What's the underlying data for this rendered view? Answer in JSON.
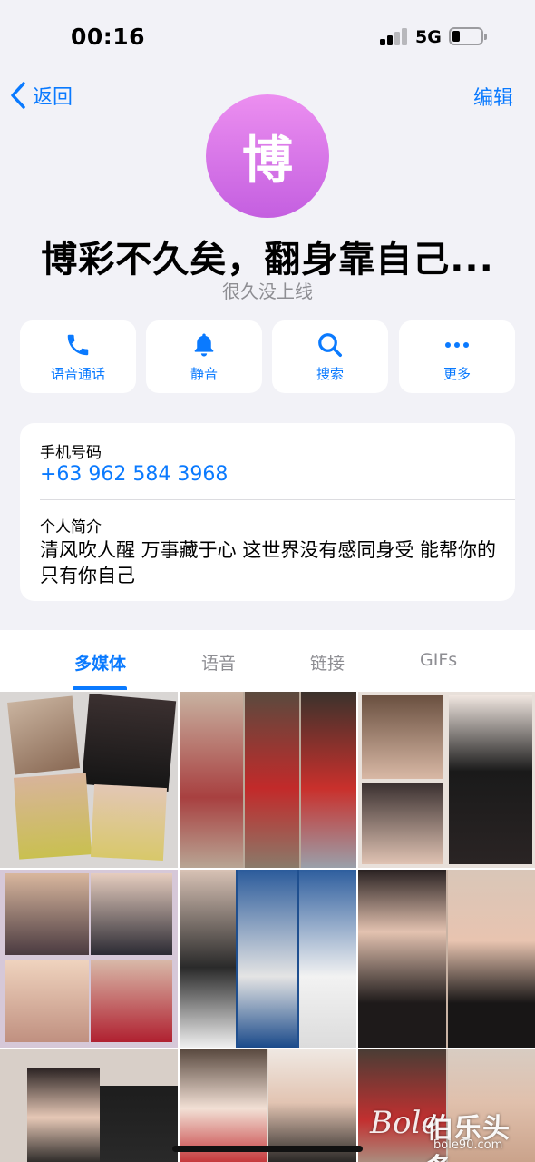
{
  "status_bar": {
    "time": "00:16",
    "network": "5G"
  },
  "nav": {
    "back_label": "返回",
    "edit_label": "编辑"
  },
  "profile": {
    "avatar_letter": "博",
    "name": "博彩不久矣，翻身靠自己...",
    "status": "很久没上线",
    "avatar_gradient": [
      "#ec8ff0",
      "#c45fe0"
    ]
  },
  "actions": [
    {
      "label": "语音通话",
      "icon": "phone-icon"
    },
    {
      "label": "静音",
      "icon": "bell-icon"
    },
    {
      "label": "搜索",
      "icon": "search-icon"
    },
    {
      "label": "更多",
      "icon": "more-icon"
    }
  ],
  "info": {
    "phone_label": "手机号码",
    "phone": "+63 962 584 3968",
    "bio_label": "个人简介",
    "bio": "清风吹人醒 万事藏于心 这世界没有感同身受 能帮你的只有你自己"
  },
  "media_tabs": [
    {
      "label": "多媒体",
      "active": true
    },
    {
      "label": "语音",
      "active": false
    },
    {
      "label": "链接",
      "active": false
    },
    {
      "label": "GIFs",
      "active": false
    }
  ],
  "watermark": {
    "logo": "Bole",
    "brand": "伯乐头条",
    "url": "bole90.com"
  },
  "colors": {
    "accent": "#0a7aff",
    "background": "#f2f2f7",
    "secondary_text": "#8e8e93"
  }
}
